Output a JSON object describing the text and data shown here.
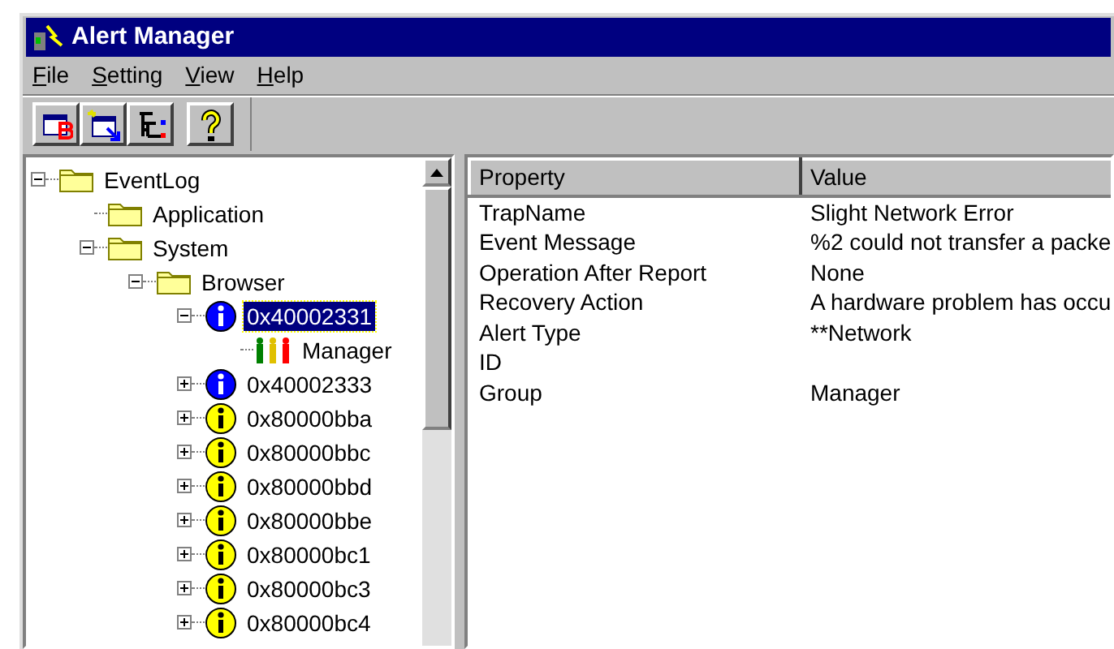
{
  "window": {
    "title": "Alert Manager"
  },
  "menu": [
    {
      "label": "File"
    },
    {
      "label": "Setting"
    },
    {
      "label": "View"
    },
    {
      "label": "Help"
    }
  ],
  "toolbar": [
    {
      "kind": "table-b"
    },
    {
      "kind": "table-new"
    },
    {
      "kind": "tree"
    },
    {
      "kind": "help"
    }
  ],
  "tree": [
    {
      "label": "EventLog",
      "kind": "folder",
      "expanded": true,
      "selected": false,
      "children": [
        {
          "label": "Application",
          "kind": "folder",
          "selected": false
        },
        {
          "label": "System",
          "kind": "folder",
          "expanded": true,
          "selected": false,
          "children": [
            {
              "label": "Browser",
              "kind": "folder",
              "expanded": true,
              "selected": false,
              "children": [
                {
                  "label": "0x40002331",
                  "kind": "info",
                  "expanded": true,
                  "selected": true,
                  "children": [
                    {
                      "label": "Manager",
                      "kind": "people",
                      "selected": false
                    }
                  ]
                },
                {
                  "label": "0x40002333",
                  "kind": "info",
                  "expanded": false,
                  "selected": false
                },
                {
                  "label": "0x80000bba",
                  "kind": "warning",
                  "expanded": false,
                  "selected": false
                },
                {
                  "label": "0x80000bbc",
                  "kind": "warning",
                  "expanded": false,
                  "selected": false
                },
                {
                  "label": "0x80000bbd",
                  "kind": "warning",
                  "expanded": false,
                  "selected": false
                },
                {
                  "label": "0x80000bbe",
                  "kind": "warning",
                  "expanded": false,
                  "selected": false
                },
                {
                  "label": "0x80000bc1",
                  "kind": "warning",
                  "expanded": false,
                  "selected": false
                },
                {
                  "label": "0x80000bc3",
                  "kind": "warning",
                  "expanded": false,
                  "selected": false
                },
                {
                  "label": "0x80000bc4",
                  "kind": "warning",
                  "expanded": false,
                  "selected": false
                }
              ]
            }
          ]
        }
      ]
    }
  ],
  "table": {
    "columns": [
      "Property",
      "Value"
    ],
    "rows": [
      [
        "TrapName",
        "Slight Network Error"
      ],
      [
        "Event Message",
        "%2 could not transfer a packe"
      ],
      [
        "Operation After Report",
        "None"
      ],
      [
        "Recovery Action",
        "A hardware problem has occu"
      ],
      [
        "Alert Type",
        "**Network"
      ],
      [
        "ID",
        ""
      ],
      [
        "Group",
        "Manager"
      ]
    ]
  }
}
